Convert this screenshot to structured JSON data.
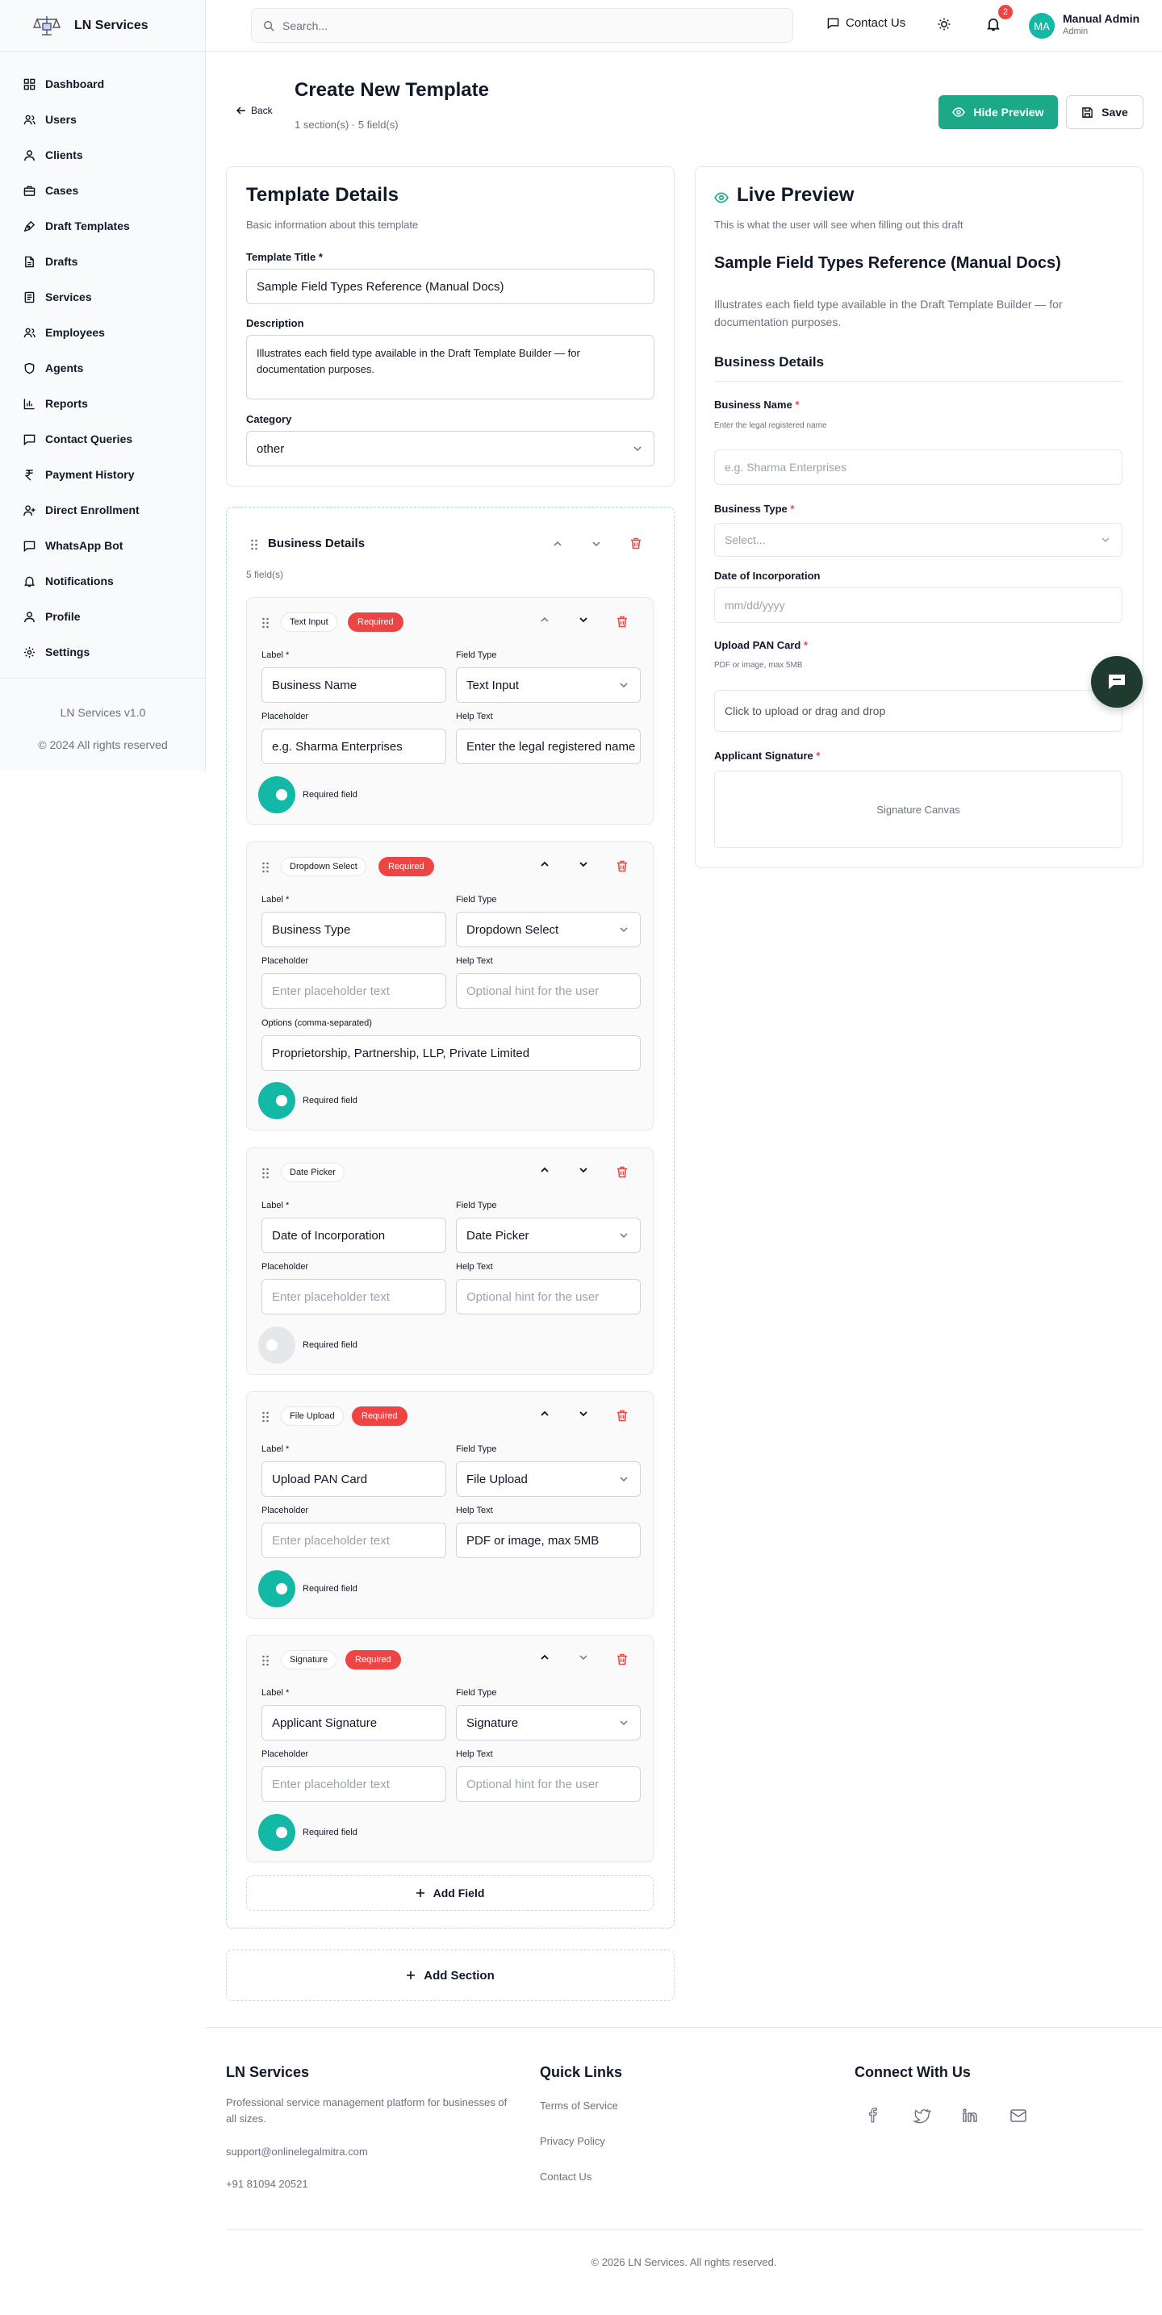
{
  "brand": {
    "name": "LN Services"
  },
  "sidebar": {
    "items": [
      {
        "label": "Dashboard",
        "icon": "grid-icon"
      },
      {
        "label": "Users",
        "icon": "users-icon"
      },
      {
        "label": "Clients",
        "icon": "user-icon"
      },
      {
        "label": "Cases",
        "icon": "briefcase-icon"
      },
      {
        "label": "Draft Templates",
        "icon": "pen-tool-icon"
      },
      {
        "label": "Drafts",
        "icon": "file-icon"
      },
      {
        "label": "Services",
        "icon": "file-text-icon"
      },
      {
        "label": "Employees",
        "icon": "users-icon"
      },
      {
        "label": "Agents",
        "icon": "shield-icon"
      },
      {
        "label": "Reports",
        "icon": "bar-chart-icon"
      },
      {
        "label": "Contact Queries",
        "icon": "message-icon"
      },
      {
        "label": "Payment History",
        "icon": "rupee-icon"
      },
      {
        "label": "Direct Enrollment",
        "icon": "user-plus-icon"
      },
      {
        "label": "WhatsApp Bot",
        "icon": "chat-icon"
      },
      {
        "label": "Notifications",
        "icon": "bell-icon"
      },
      {
        "label": "Profile",
        "icon": "user-icon"
      },
      {
        "label": "Settings",
        "icon": "settings-icon"
      }
    ],
    "version": "LN Services v1.0",
    "copyright": "© 2024 All rights reserved"
  },
  "topbar": {
    "search_placeholder": "Search...",
    "contact_label": "Contact Us",
    "notification_count": "2",
    "avatar_initials": "MA",
    "user_name": "Manual Admin",
    "user_role": "Admin"
  },
  "page": {
    "back_label": "Back",
    "title": "Create New Template",
    "subtitle": "1 section(s) · 5 field(s)",
    "hide_preview_label": "Hide Preview",
    "save_label": "Save"
  },
  "details": {
    "title": "Template Details",
    "subtitle": "Basic information about this template",
    "title_label": "Template Title *",
    "title_value": "Sample Field Types Reference (Manual Docs)",
    "description_label": "Description",
    "description_value": "Illustrates each field type available in the Draft Template Builder — for documentation purposes.",
    "category_label": "Category",
    "category_value": "other"
  },
  "section": {
    "title": "Business Details",
    "count": "5 field(s)",
    "labels": {
      "label": "Label *",
      "field_type": "Field Type",
      "placeholder": "Placeholder",
      "help_text": "Help Text",
      "options": "Options (comma-separated)",
      "required_field": "Required field",
      "required_badge": "Required"
    },
    "fields": [
      {
        "type_pill": "Text Input",
        "required": true,
        "label": "Business Name",
        "field_type": "Text Input",
        "placeholder": "e.g. Sharma Enterprises",
        "help_text": "Enter the legal registered name"
      },
      {
        "type_pill": "Dropdown Select",
        "required": true,
        "label": "Business Type",
        "field_type": "Dropdown Select",
        "placeholder": "Enter placeholder text",
        "help_text": "Optional hint for the user",
        "options": "Proprietorship, Partnership, LLP, Private Limited"
      },
      {
        "type_pill": "Date Picker",
        "required": false,
        "label": "Date of Incorporation",
        "field_type": "Date Picker",
        "placeholder": "Enter placeholder text",
        "help_text": "Optional hint for the user"
      },
      {
        "type_pill": "File Upload",
        "required": true,
        "label": "Upload PAN Card",
        "field_type": "File Upload",
        "placeholder": "Enter placeholder text",
        "help_text": "PDF or image, max 5MB"
      },
      {
        "type_pill": "Signature",
        "required": true,
        "label": "Applicant Signature",
        "field_type": "Signature",
        "placeholder": "Enter placeholder text",
        "help_text": "Optional hint for the user"
      }
    ],
    "add_field_label": "Add Field"
  },
  "add_section_label": "Add Section",
  "preview": {
    "title": "Live Preview",
    "subtitle": "This is what the user will see when filling out this draft",
    "doc_title": "Sample Field Types Reference (Manual Docs)",
    "doc_desc": "Illustrates each field type available in the Draft Template Builder — for documentation purposes.",
    "section_title": "Business Details",
    "business_name_label": "Business Name",
    "business_name_help": "Enter the legal registered name",
    "business_name_placeholder": "e.g. Sharma Enterprises",
    "business_type_label": "Business Type",
    "business_type_placeholder": "Select...",
    "doi_label": "Date of Incorporation",
    "doi_placeholder": "mm/dd/yyyy",
    "pan_label": "Upload PAN Card",
    "pan_help": "PDF or image, max 5MB",
    "pan_upload_text": "Click to upload or drag and drop",
    "sig_label": "Applicant Signature",
    "sig_canvas": "Signature Canvas",
    "required_mark": "*"
  },
  "footer": {
    "brand": "LN Services",
    "tagline": "Professional service management platform for businesses of all sizes.",
    "email": "support@onlinelegalmitra.com",
    "phone": "+91 81094 20521",
    "quick_links_title": "Quick Links",
    "links": [
      "Terms of Service",
      "Privacy Policy",
      "Contact Us"
    ],
    "connect_title": "Connect With Us",
    "social": [
      "facebook-icon",
      "twitter-icon",
      "linkedin-icon",
      "mail-icon"
    ],
    "copyright": "© 2026 LN Services. All rights reserved."
  },
  "colors": {
    "accent": "#1ca98a",
    "danger": "#ef4444",
    "chat": "#1f3a2f"
  }
}
